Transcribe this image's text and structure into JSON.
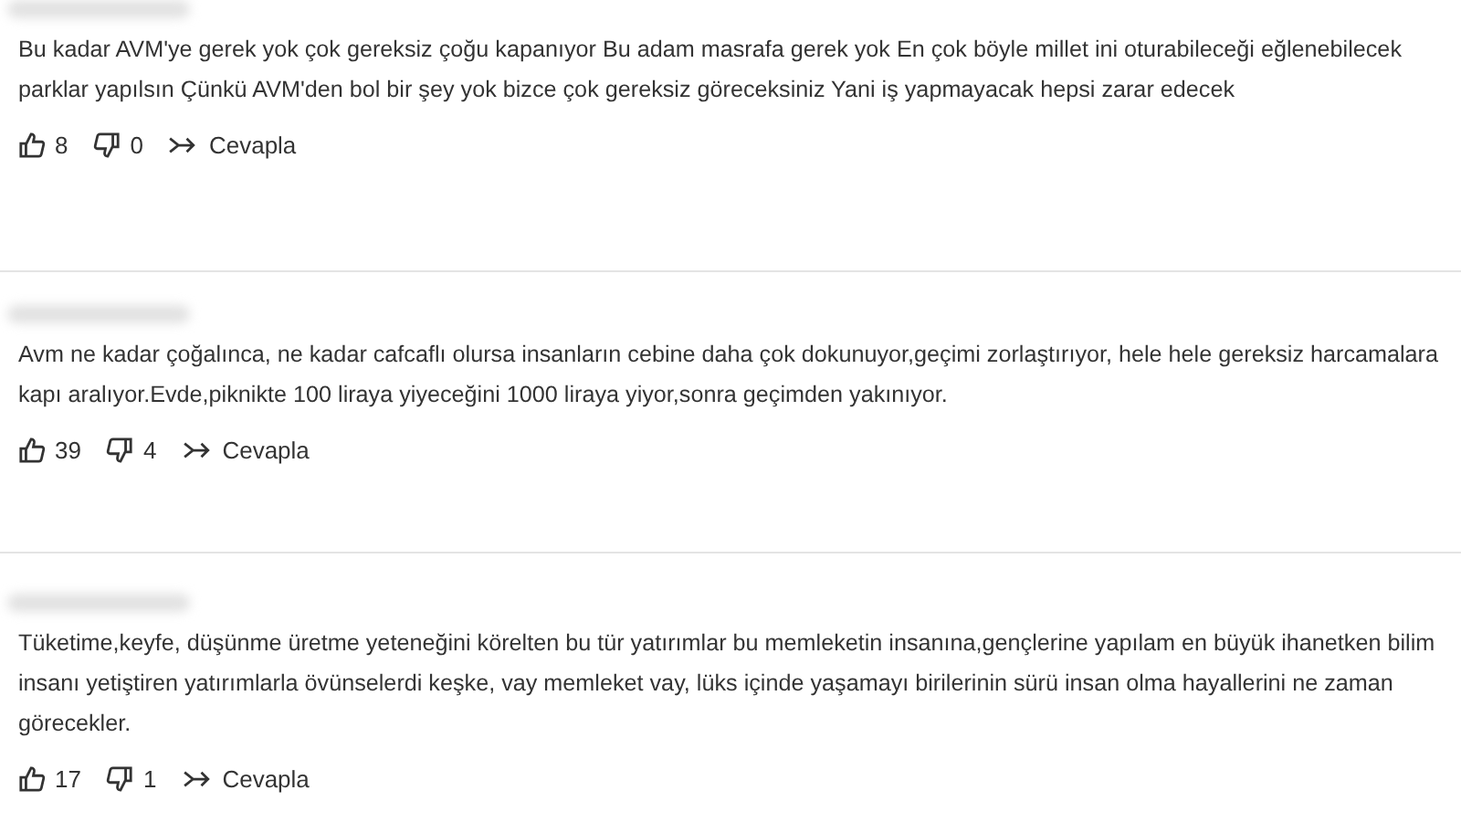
{
  "comments": [
    {
      "text": "Bu kadar AVM'ye gerek yok çok gereksiz çoğu kapanıyor Bu adam masrafa gerek yok En çok böyle millet ini oturabileceği eğlenebilecek parklar yapılsın Çünkü AVM'den bol bir şey yok bizce çok gereksiz göreceksiniz Yani iş yapmayacak hepsi zarar edecek",
      "likes": "8",
      "dislikes": "0",
      "reply": "Cevapla"
    },
    {
      "text": "Avm ne kadar çoğalınca, ne kadar cafcaflı olursa insanların cebine daha çok dokunuyor,geçimi zorlaştırıyor, hele hele gereksiz harcamalara kapı aralıyor.Evde,piknikte 100 liraya yiyeceğini 1000 liraya yiyor,sonra geçimden yakınıyor.",
      "likes": "39",
      "dislikes": "4",
      "reply": "Cevapla"
    },
    {
      "text": "Tüketime,keyfe, düşünme üretme yeteneğini körelten bu tür yatırımlar bu memleketin insanına,gençlerine yapılam en büyük ihanetken bilim insanı yetiştiren yatırımlarla övünselerdi keşke, vay memleket vay, lüks içinde yaşamayı birilerinin sürü insan olma hayallerini ne zaman görecekler.",
      "likes": "17",
      "dislikes": "1",
      "reply": "Cevapla"
    }
  ]
}
